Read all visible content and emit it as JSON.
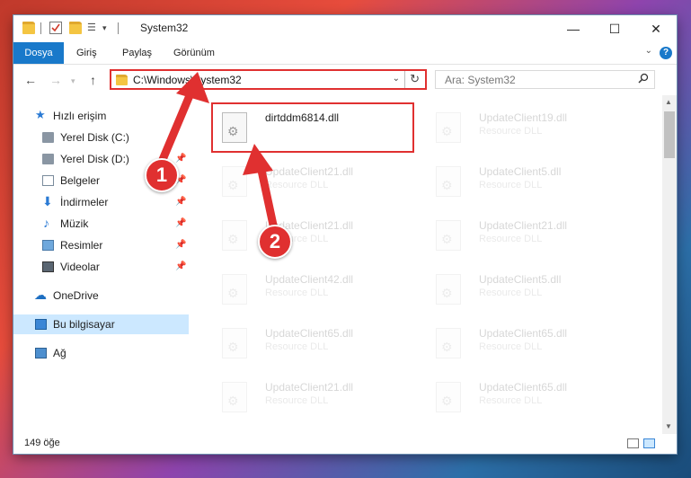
{
  "window": {
    "title": "System32",
    "controls": {
      "minimize": "—",
      "maximize": "☐",
      "close": "✕"
    }
  },
  "ribbon": {
    "tabs": [
      {
        "label": "Dosya",
        "active": true
      },
      {
        "label": "Giriş"
      },
      {
        "label": "Paylaş"
      },
      {
        "label": "Görünüm"
      }
    ],
    "help": "?"
  },
  "address": {
    "path": "C:\\Windows\\System32",
    "search_placeholder": "Ara: System32"
  },
  "nav": {
    "items": [
      {
        "label": "Hızlı erişim",
        "icon": "star-icon",
        "pinned": false
      },
      {
        "label": "Yerel Disk (C:)",
        "icon": "drive-icon",
        "pinned": true
      },
      {
        "label": "Yerel Disk (D:)",
        "icon": "drive-icon",
        "pinned": true
      },
      {
        "label": "Belgeler",
        "icon": "documents-icon",
        "pinned": true
      },
      {
        "label": "İndirmeler",
        "icon": "download-icon",
        "pinned": true
      },
      {
        "label": "Müzik",
        "icon": "music-icon",
        "pinned": true
      },
      {
        "label": "Resimler",
        "icon": "pictures-icon",
        "pinned": true
      },
      {
        "label": "Videolar",
        "icon": "videos-icon",
        "pinned": true
      },
      {
        "label": "OneDrive",
        "icon": "cloud-icon",
        "pinned": false
      },
      {
        "label": "Bu bilgisayar",
        "icon": "computer-icon",
        "pinned": false,
        "selected": true
      },
      {
        "label": "Ağ",
        "icon": "network-icon",
        "pinned": false
      }
    ]
  },
  "files": [
    {
      "name": "dirtddm6814.dll",
      "type": "",
      "highlighted": true
    },
    {
      "name": "UpdateClient19.dll",
      "type": "Resource DLL"
    },
    {
      "name": "UpdateClient21.dll",
      "type": "Resource DLL"
    },
    {
      "name": "UpdateClient5.dll",
      "type": "Resource DLL"
    },
    {
      "name": "UpdateClient21.dll",
      "type": "Resource DLL"
    },
    {
      "name": "UpdateClient21.dll",
      "type": "Resource DLL"
    },
    {
      "name": "UpdateClient42.dll",
      "type": "Resource DLL"
    },
    {
      "name": "UpdateClient5.dll",
      "type": "Resource DLL"
    },
    {
      "name": "UpdateClient65.dll",
      "type": "Resource DLL"
    },
    {
      "name": "UpdateClient65.dll",
      "type": "Resource DLL"
    },
    {
      "name": "UpdateClient21.dll",
      "type": "Resource DLL"
    },
    {
      "name": "UpdateClient65.dll",
      "type": "Resource DLL"
    }
  ],
  "status": {
    "count": "149 öğe"
  },
  "annotations": {
    "badge1": "1",
    "badge2": "2",
    "accent": "#e03030"
  }
}
